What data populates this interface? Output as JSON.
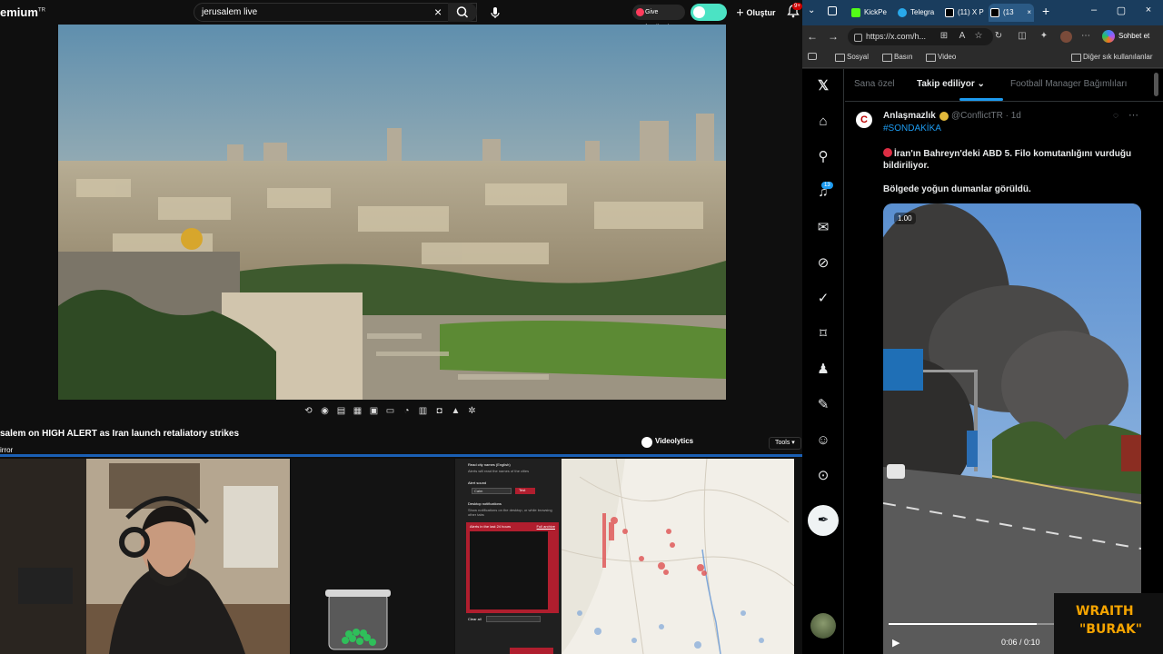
{
  "youtube": {
    "logo_text": "emium",
    "logo_sup": "TR",
    "search_query": "jerusalem live",
    "feedback_label": "Give feedback",
    "create_label": "Oluştur",
    "notif_count": "9+",
    "video_title": "salem on HIGH ALERT as Iran launch retaliatory strikes",
    "channel_name": "irror",
    "videolytics_label": "Videolytics",
    "tools_label": "Tools"
  },
  "alerts_panel": {
    "lines": [
      "Read city names (English)",
      "Alerts will read the names of the cities",
      "Alert sound",
      "Calm",
      "Test",
      "Desktop notifications",
      "Show notifications on the desktop, or while browsing other tabs",
      "Alerts in the last 24 hours",
      "Full archive",
      "Clear all"
    ]
  },
  "browser": {
    "tabs": [
      {
        "label": "KickPe",
        "color": "#53fc18"
      },
      {
        "label": "Telegra",
        "color": "#29a9eb"
      },
      {
        "label": "(11) X P",
        "color": "#000000"
      },
      {
        "label": "(13",
        "color": "#000000"
      }
    ],
    "url": "https://x.com/h...",
    "copilot_label": "Sohbet et",
    "bookmarks": [
      "Sosyal",
      "Basın",
      "Video"
    ],
    "other_bookmarks": "Diğer sık kullanılanlar"
  },
  "x": {
    "tabs": [
      "Sana özel",
      "Takip ediliyor",
      "Football Manager Bağımlıları"
    ],
    "notif_badge": "13",
    "tweet": {
      "avatar_letter": "C",
      "name": "Anlaşmazlık",
      "handle": "@ConflictTR · 1d",
      "hashtag": "#SONDAKİKA",
      "text": "İran'ın Bahreyn'deki ABD 5. Filo komutanlığını vurduğu bildiriliyor.",
      "text2": "Bölgede yoğun dumanlar görüldü.",
      "speed": "1.00",
      "time": "0:06 / 0:10",
      "progress": 0.6
    }
  },
  "overlay": {
    "line1": "WRAITH",
    "line2": "\"BURAK\""
  }
}
